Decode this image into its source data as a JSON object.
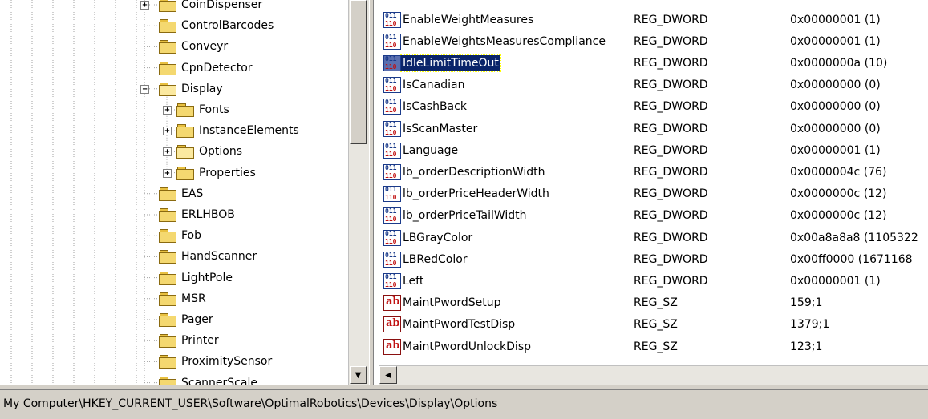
{
  "tree": {
    "items": [
      {
        "label": "CoinDispenser",
        "depth": 2,
        "expander": "+"
      },
      {
        "label": "ControlBarcodes",
        "depth": 2,
        "expander": ""
      },
      {
        "label": "Conveyr",
        "depth": 2,
        "expander": ""
      },
      {
        "label": "CpnDetector",
        "depth": 2,
        "expander": ""
      },
      {
        "label": "Display",
        "depth": 2,
        "expander": "−",
        "open": true
      },
      {
        "label": "Fonts",
        "depth": 3,
        "expander": "+"
      },
      {
        "label": "InstanceElements",
        "depth": 3,
        "expander": "+"
      },
      {
        "label": "Options",
        "depth": 3,
        "expander": "+",
        "open": true
      },
      {
        "label": "Properties",
        "depth": 3,
        "expander": "+"
      },
      {
        "label": "EAS",
        "depth": 2,
        "expander": ""
      },
      {
        "label": "ERLHBOB",
        "depth": 2,
        "expander": ""
      },
      {
        "label": "Fob",
        "depth": 2,
        "expander": ""
      },
      {
        "label": "HandScanner",
        "depth": 2,
        "expander": ""
      },
      {
        "label": "LightPole",
        "depth": 2,
        "expander": ""
      },
      {
        "label": "MSR",
        "depth": 2,
        "expander": ""
      },
      {
        "label": "Pager",
        "depth": 2,
        "expander": ""
      },
      {
        "label": "Printer",
        "depth": 2,
        "expander": ""
      },
      {
        "label": "ProximitySensor",
        "depth": 2,
        "expander": ""
      },
      {
        "label": "ScannerScale",
        "depth": 2,
        "expander": ""
      }
    ]
  },
  "values": {
    "rows": [
      {
        "name": "EnableWeightMeasures",
        "type": "REG_DWORD",
        "data": "0x00000001 (1)",
        "icon": "binary-value-icon"
      },
      {
        "name": "EnableWeightsMeasuresCompliance",
        "type": "REG_DWORD",
        "data": "0x00000001 (1)",
        "icon": "binary-value-icon"
      },
      {
        "name": "IdleLimitTimeOut",
        "type": "REG_DWORD",
        "data": "0x0000000a (10)",
        "icon": "binary-value-icon",
        "selected": true
      },
      {
        "name": "IsCanadian",
        "type": "REG_DWORD",
        "data": "0x00000000 (0)",
        "icon": "binary-value-icon"
      },
      {
        "name": "IsCashBack",
        "type": "REG_DWORD",
        "data": "0x00000000 (0)",
        "icon": "binary-value-icon"
      },
      {
        "name": "IsScanMaster",
        "type": "REG_DWORD",
        "data": "0x00000000 (0)",
        "icon": "binary-value-icon"
      },
      {
        "name": "Language",
        "type": "REG_DWORD",
        "data": "0x00000001 (1)",
        "icon": "binary-value-icon"
      },
      {
        "name": "lb_orderDescriptionWidth",
        "type": "REG_DWORD",
        "data": "0x0000004c (76)",
        "icon": "binary-value-icon"
      },
      {
        "name": "lb_orderPriceHeaderWidth",
        "type": "REG_DWORD",
        "data": "0x0000000c (12)",
        "icon": "binary-value-icon"
      },
      {
        "name": "lb_orderPriceTailWidth",
        "type": "REG_DWORD",
        "data": "0x0000000c (12)",
        "icon": "binary-value-icon"
      },
      {
        "name": "LBGrayColor",
        "type": "REG_DWORD",
        "data": "0x00a8a8a8 (1105322",
        "icon": "binary-value-icon"
      },
      {
        "name": "LBRedColor",
        "type": "REG_DWORD",
        "data": "0x00ff0000 (1671168",
        "icon": "binary-value-icon"
      },
      {
        "name": "Left",
        "type": "REG_DWORD",
        "data": "0x00000001 (1)",
        "icon": "binary-value-icon"
      },
      {
        "name": "MaintPwordSetup",
        "type": "REG_SZ",
        "data": "159;1",
        "icon": "string-value-icon"
      },
      {
        "name": "MaintPwordTestDisp",
        "type": "REG_SZ",
        "data": "1379;1",
        "icon": "string-value-icon"
      },
      {
        "name": "MaintPwordUnlockDisp",
        "type": "REG_SZ",
        "data": "123;1",
        "icon": "string-value-icon"
      }
    ]
  },
  "statusbar": {
    "path": "My Computer\\HKEY_CURRENT_USER\\Software\\OptimalRobotics\\Devices\\Display\\Options"
  },
  "scrollbars": {
    "down_arrow": "▼",
    "left_arrow": "◀"
  },
  "colors": {
    "selection": "#0a246a",
    "chrome": "#d4d0c8",
    "folder": "#f4d870"
  }
}
